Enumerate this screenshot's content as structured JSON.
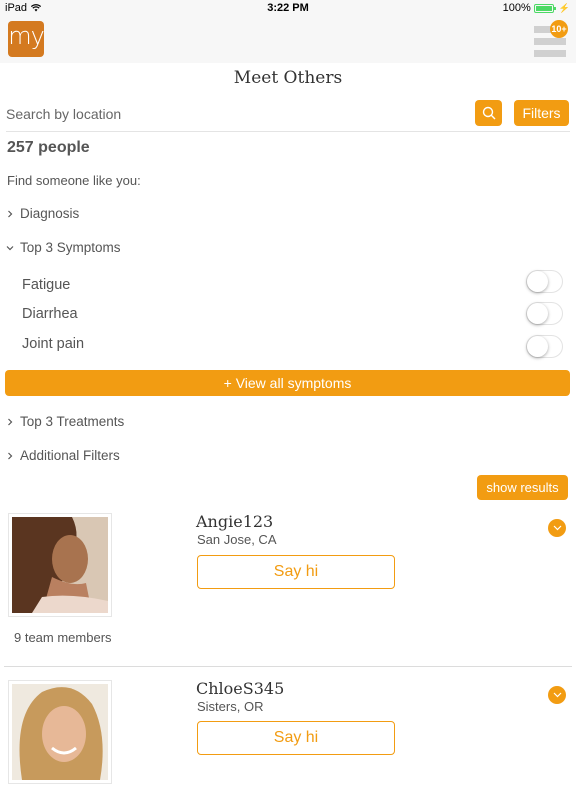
{
  "status_bar": {
    "device": "iPad",
    "time": "3:22 PM",
    "battery": "100%",
    "battery_level": 1.0
  },
  "header": {
    "logo_text": "my",
    "menu_badge": "10+"
  },
  "page": {
    "title": "Meet Others"
  },
  "search": {
    "placeholder": "Search by location",
    "value": "",
    "filters_label": "Filters"
  },
  "results": {
    "count_label": "257 people"
  },
  "filters": {
    "intro": "Find someone like you:",
    "sections": [
      {
        "label": "Diagnosis",
        "expanded": false
      },
      {
        "label": "Top 3 Symptoms",
        "expanded": true
      },
      {
        "label": "Top 3 Treatments",
        "expanded": false
      },
      {
        "label": "Additional Filters",
        "expanded": false
      }
    ],
    "symptoms": [
      {
        "label": "Fatigue",
        "on": false
      },
      {
        "label": "Diarrhea",
        "on": false
      },
      {
        "label": "Joint pain",
        "on": false
      }
    ],
    "view_all_label": "+ View all symptoms",
    "show_results_label": "show results"
  },
  "colors": {
    "accent": "#f29c12",
    "logo": "#d47a20"
  },
  "people": [
    {
      "username": "Angie123",
      "location": "San Jose, CA",
      "say_hi": "Say hi",
      "team": "9 team members"
    },
    {
      "username": "ChloeS345",
      "location": "Sisters, OR",
      "say_hi": "Say hi",
      "team": ""
    }
  ]
}
